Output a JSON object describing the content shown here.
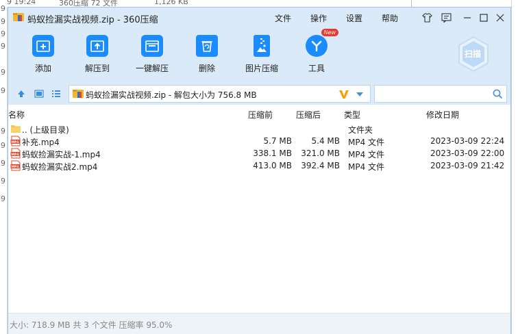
{
  "background": {
    "top_strip": [
      "9 19:24",
      "360压缩 72 文件",
      "1,126 KB"
    ],
    "left_digits": [
      "9",
      "9",
      "9",
      "9",
      "9",
      "9",
      "9",
      "9",
      "9",
      "9",
      "9"
    ]
  },
  "window": {
    "title": "蚂蚁捡漏实战视频.zip - 360压缩",
    "menu": [
      "文件",
      "操作",
      "设置",
      "帮助"
    ]
  },
  "toolbar": {
    "items": [
      {
        "label": "添加",
        "icon": "add-file-icon"
      },
      {
        "label": "解压到",
        "icon": "extract-to-icon"
      },
      {
        "label": "一键解压",
        "icon": "quick-extract-icon"
      },
      {
        "label": "删除",
        "icon": "trash-icon"
      },
      {
        "label": "图片压缩",
        "icon": "image-compress-icon"
      },
      {
        "label": "工具",
        "icon": "tools-icon"
      }
    ],
    "new_badge": "New",
    "scan_label": "扫描"
  },
  "address": {
    "path": "蚂蚁捡漏实战视频.zip - 解包大小为 756.8 MB",
    "search_placeholder": ""
  },
  "columns": {
    "name": "名称",
    "size": "压缩前",
    "packed": "压缩后",
    "type": "类型",
    "modified": "修改日期"
  },
  "files": [
    {
      "name": ".. (上级目录)",
      "size": "",
      "packed": "",
      "type": "文件夹",
      "modified": "",
      "kind": "folder"
    },
    {
      "name": "补充.mp4",
      "size": "5.7 MB",
      "packed": "5.4 MB",
      "type": "MP4 文件",
      "modified": "2023-03-09 22:24",
      "kind": "mp4"
    },
    {
      "name": "蚂蚁捡漏实战-1.mp4",
      "size": "338.1 MB",
      "packed": "321.0 MB",
      "type": "MP4 文件",
      "modified": "2023-03-09 22:00",
      "kind": "mp4"
    },
    {
      "name": "蚂蚁捡漏实战2.mp4",
      "size": "413.0 MB",
      "packed": "392.4 MB",
      "type": "MP4 文件",
      "modified": "2023-03-09 21:42",
      "kind": "mp4"
    }
  ],
  "status": "大小: 718.9 MB 共 3 个文件 压缩率 95.0%",
  "colors": {
    "accent": "#1a8cff",
    "toolbar_bg": "#dbeaf8",
    "folder": "#f6c94a",
    "mp4": "#e0452d"
  }
}
